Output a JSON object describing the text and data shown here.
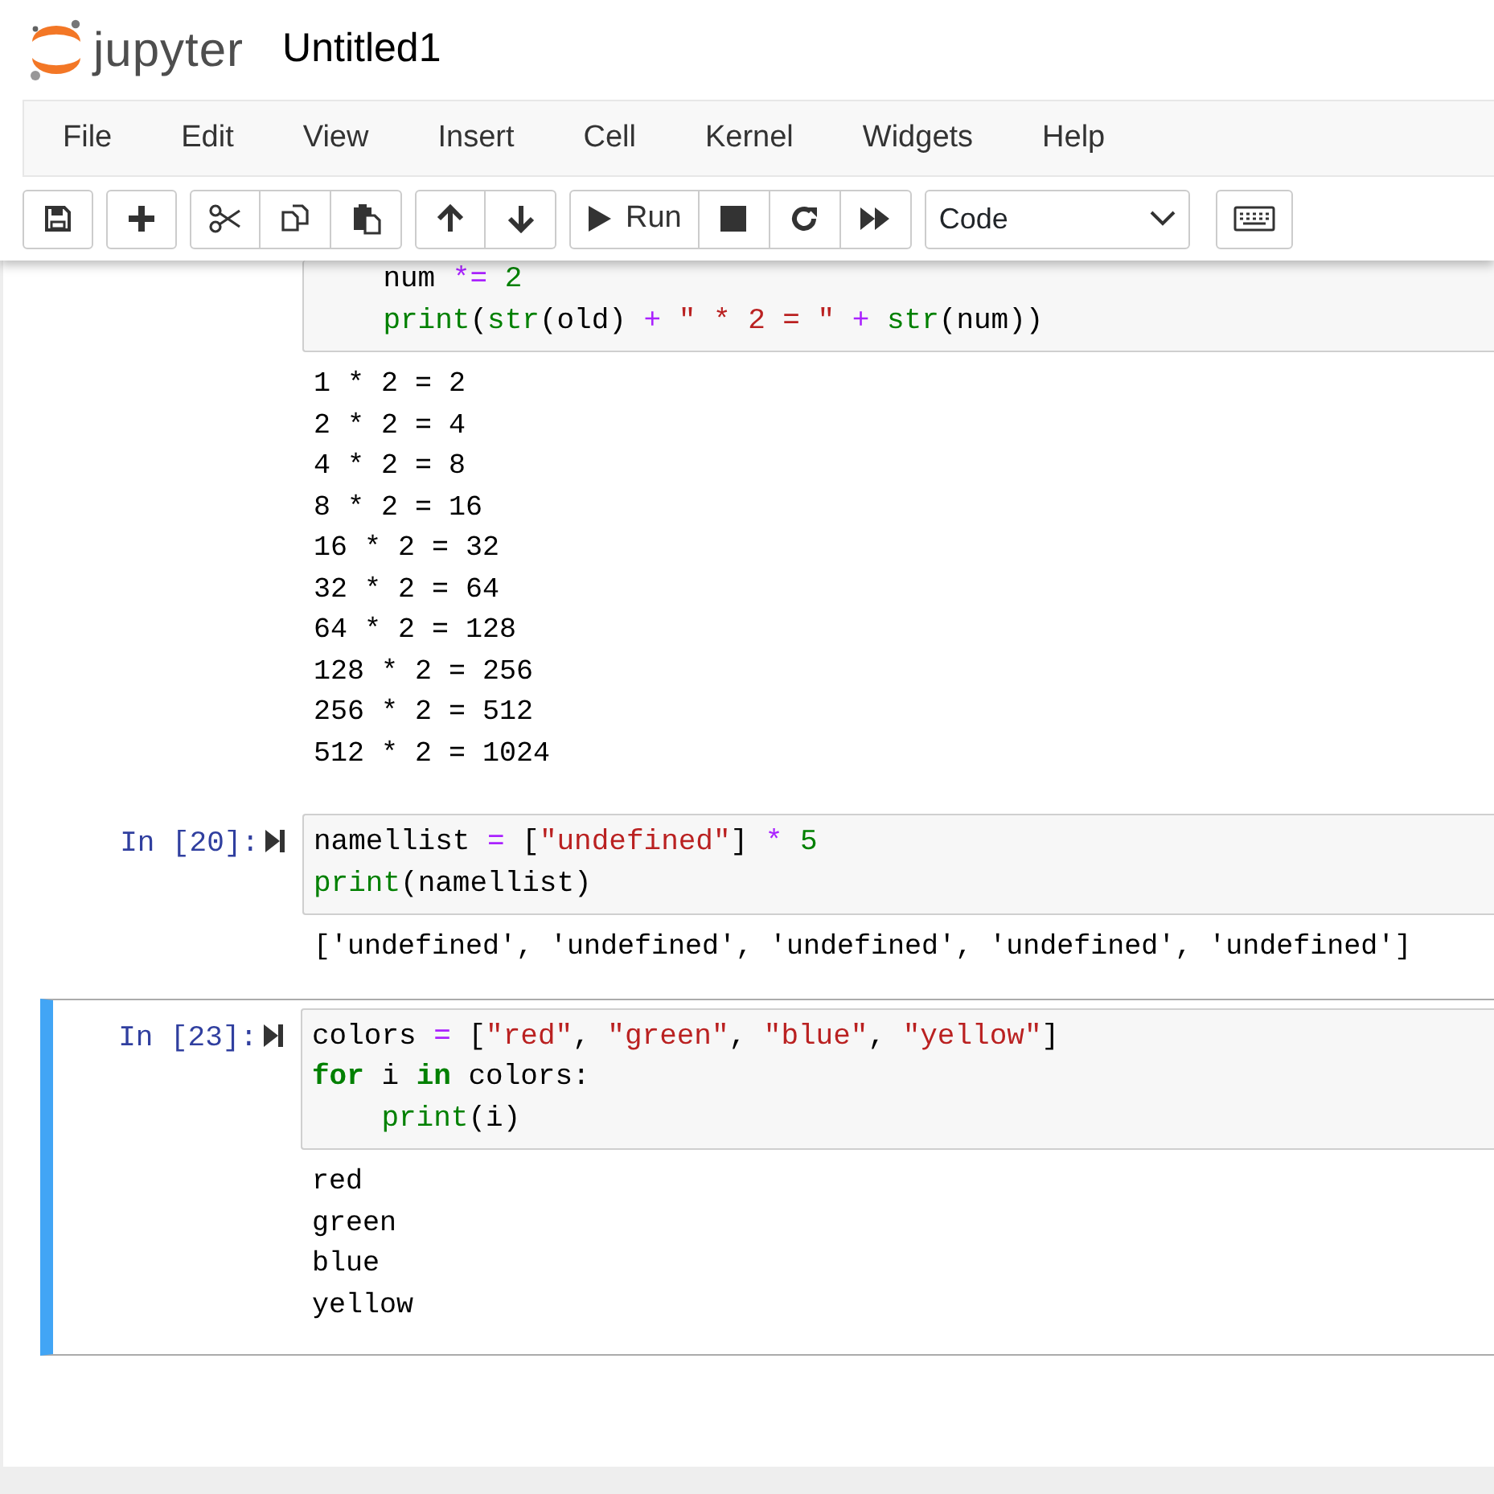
{
  "header": {
    "logo_text": "jupyter",
    "notebook_title": "Untitled1"
  },
  "menu": [
    "File",
    "Edit",
    "View",
    "Insert",
    "Cell",
    "Kernel",
    "Widgets",
    "Help"
  ],
  "toolbar": {
    "run_label": "Run",
    "cell_type": "Code"
  },
  "cells": [
    {
      "selected": false,
      "input": [
        [
          {
            "kind": "plain",
            "text": "    num "
          },
          {
            "kind": "op",
            "text": "*="
          },
          {
            "kind": "num",
            "text": " 2"
          }
        ],
        [
          {
            "kind": "builtin",
            "text": "    print"
          },
          {
            "kind": "plain",
            "text": "("
          },
          {
            "kind": "builtin",
            "text": "str"
          },
          {
            "kind": "plain",
            "text": "(old) "
          },
          {
            "kind": "op",
            "text": "+ "
          },
          {
            "kind": "str",
            "text": "\" * 2 = \" "
          },
          {
            "kind": "op",
            "text": "+ "
          },
          {
            "kind": "builtin",
            "text": "str"
          },
          {
            "kind": "plain",
            "text": "(num))"
          }
        ]
      ],
      "output": [
        "1 * 2 = 2",
        "2 * 2 = 4",
        "4 * 2 = 8",
        "8 * 2 = 16",
        "16 * 2 = 32",
        "32 * 2 = 64",
        "64 * 2 = 128",
        "128 * 2 = 256",
        "256 * 2 = 512",
        "512 * 2 = 1024"
      ]
    },
    {
      "prompt": "In [20]:",
      "selected": false,
      "input": [
        [
          {
            "kind": "plain",
            "text": "namellist "
          },
          {
            "kind": "op",
            "text": "= "
          },
          {
            "kind": "plain",
            "text": "["
          },
          {
            "kind": "str",
            "text": "\"undefined\""
          },
          {
            "kind": "plain",
            "text": "] "
          },
          {
            "kind": "op",
            "text": "* "
          },
          {
            "kind": "num",
            "text": "5"
          }
        ],
        [
          {
            "kind": "builtin",
            "text": "print"
          },
          {
            "kind": "plain",
            "text": "(namellist)"
          }
        ]
      ],
      "output": [
        "['undefined', 'undefined', 'undefined', 'undefined', 'undefined']"
      ]
    },
    {
      "prompt": "In [23]:",
      "selected": true,
      "input": [
        [
          {
            "kind": "plain",
            "text": "colors "
          },
          {
            "kind": "op",
            "text": "= "
          },
          {
            "kind": "plain",
            "text": "["
          },
          {
            "kind": "str",
            "text": "\"red\""
          },
          {
            "kind": "plain",
            "text": ", "
          },
          {
            "kind": "str",
            "text": "\"green\""
          },
          {
            "kind": "plain",
            "text": ", "
          },
          {
            "kind": "str",
            "text": "\"blue\""
          },
          {
            "kind": "plain",
            "text": ", "
          },
          {
            "kind": "str",
            "text": "\"yellow\""
          },
          {
            "kind": "plain",
            "text": "]"
          }
        ],
        [
          {
            "kind": "kw",
            "text": "for"
          },
          {
            "kind": "plain",
            "text": " i "
          },
          {
            "kind": "kw",
            "text": "in"
          },
          {
            "kind": "plain",
            "text": " colors:"
          }
        ],
        [
          {
            "kind": "builtin",
            "text": "    print"
          },
          {
            "kind": "plain",
            "text": "(i)"
          }
        ]
      ],
      "output": [
        "red",
        "green",
        "blue",
        "yellow"
      ]
    }
  ]
}
